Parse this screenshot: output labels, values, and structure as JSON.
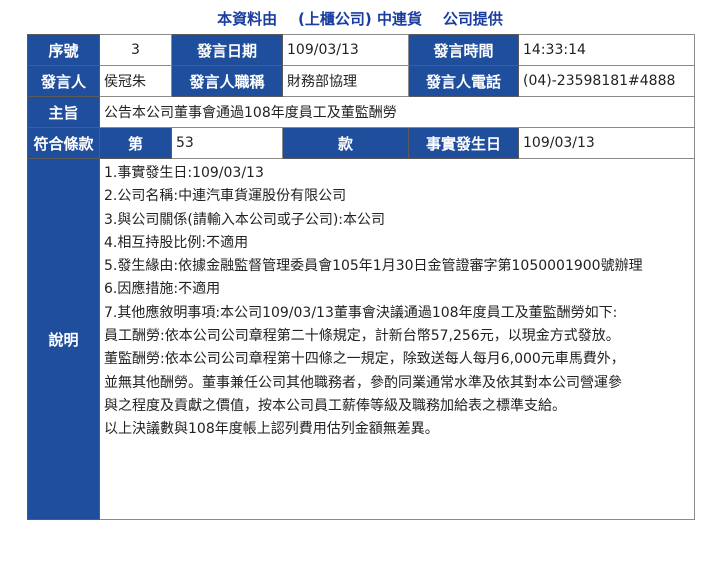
{
  "header": {
    "prefix": "本資料由",
    "company": "(上櫃公司) 中連貨",
    "suffix": "公司提供"
  },
  "rows": {
    "seq_label": "序號",
    "seq_value": "3",
    "date_label": "發言日期",
    "date_value": "109/03/13",
    "time_label": "發言時間",
    "time_value": "14:33:14",
    "speaker_label": "發言人",
    "speaker_value": "侯冠朱",
    "title_label": "發言人職稱",
    "title_value": "財務部協理",
    "phone_label": "發言人電話",
    "phone_value": "(04)-23598181#4888",
    "subject_label": "主旨",
    "subject_value": "公告本公司董事會通過108年度員工及董監酬勞",
    "clause_label": "符合條款",
    "clause_article_label": "第",
    "clause_article_value": "53",
    "clause_section_label": "款",
    "event_date_label": "事實發生日",
    "event_date_value": "109/03/13",
    "desc_label": "說明"
  },
  "description": [
    "1.事實發生日:109/03/13",
    "2.公司名稱:中連汽車貨運股份有限公司",
    "3.與公司關係(請輸入本公司或子公司):本公司",
    "4.相互持股比例:不適用",
    "5.發生緣由:依據金融監督管理委員會105年1月30日金管證審字第1050001900號辦理",
    "6.因應措施:不適用",
    "7.其他應敘明事項:本公司109/03/13董事會決議通過108年度員工及董監酬勞如下:",
    "員工酬勞:依本公司公司章程第二十條規定，計新台幣57,256元，以現金方式發放。",
    "董監酬勞:依本公司公司章程第十四條之一規定，除致送每人每月6,000元車馬費外，",
    "並無其他酬勞。董事兼任公司其他職務者，參酌同業通常水準及依其對本公司營運參",
    "與之程度及貢獻之價值，按本公司員工薪俸等級及職務加給表之標準支給。",
    "以上決議數與108年度帳上認列費用估列金額無差異。"
  ]
}
